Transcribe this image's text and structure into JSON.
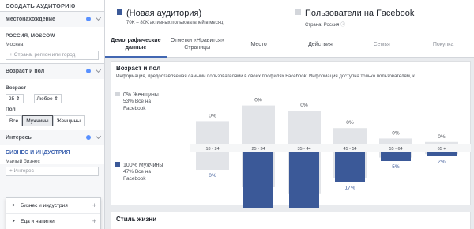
{
  "colors": {
    "accent": "#4267b2",
    "female_bar": "#d3d6db",
    "male_bar": "#3b5998",
    "fb_bar": "#e2e4e8"
  },
  "sidebar": {
    "header": "СОЗДАТЬ АУДИТОРИЮ",
    "location_section": "Местонахождение",
    "location_title": "РОССИЯ, MOSCOW",
    "location_sub": "Москва",
    "location_placeholder": "Страна, регион или город",
    "age_gender_section": "Возраст и пол",
    "age_label": "Возраст",
    "age_from": "25",
    "age_to": "Любое",
    "gender_label": "Пол",
    "gender_options": [
      "Все",
      "Мужчины",
      "Женщины"
    ],
    "gender_active": "Мужчины",
    "interests_section": "Интересы",
    "business_title": "БИЗНЕС И ИНДУСТРИЯ",
    "business_sub": "Малый бизнес",
    "interest_placeholder": "Интерес",
    "interest_options": [
      "Бизнес и индустрия",
      "Еда и напитки"
    ]
  },
  "header": {
    "audience_title": "(Новая аудитория)",
    "audience_sub": "70K – 80K активных пользователей в месяц",
    "facebook_title": "Пользователи на Facebook",
    "facebook_sub": "Страна: Россия",
    "tabs": [
      {
        "label": "Демографические данные",
        "active": true
      },
      {
        "label": "Отметки «Нравится» Страницы",
        "active": false
      },
      {
        "label": "Место",
        "active": false
      },
      {
        "label": "Действия",
        "active": false
      },
      {
        "label": "Семья",
        "active": false,
        "muted": true
      },
      {
        "label": "Покупка",
        "active": false,
        "muted": true
      }
    ]
  },
  "card": {
    "title": "Возраст и пол",
    "description": "Информация, предоставляемая самыми пользователями в своих профилях Facebook. Информация доступна только пользователям, к...",
    "women_legend": "0% Женщины",
    "women_sub_1": "53% Все на",
    "women_sub_2": "Facebook",
    "men_legend": "100% Мужчины",
    "men_sub_1": "47% Все на",
    "men_sub_2": "Facebook"
  },
  "chart_data": {
    "type": "bar",
    "categories": [
      "18 - 24",
      "25 - 34",
      "35 - 44",
      "45 - 54",
      "55 - 64",
      "65 +"
    ],
    "series": [
      {
        "name": "Женщины",
        "values": [
          0,
          0,
          0,
          0,
          0,
          0
        ]
      },
      {
        "name": "Мужчины",
        "values": [
          0,
          34,
          43,
          17,
          5,
          2
        ]
      }
    ],
    "facebook_women_values": [
      13,
      22,
      19,
      9,
      3,
      1
    ],
    "facebook_men_values": [
      10,
      20,
      24,
      15,
      3,
      1
    ]
  },
  "card2": {
    "title": "Стиль жизни"
  }
}
